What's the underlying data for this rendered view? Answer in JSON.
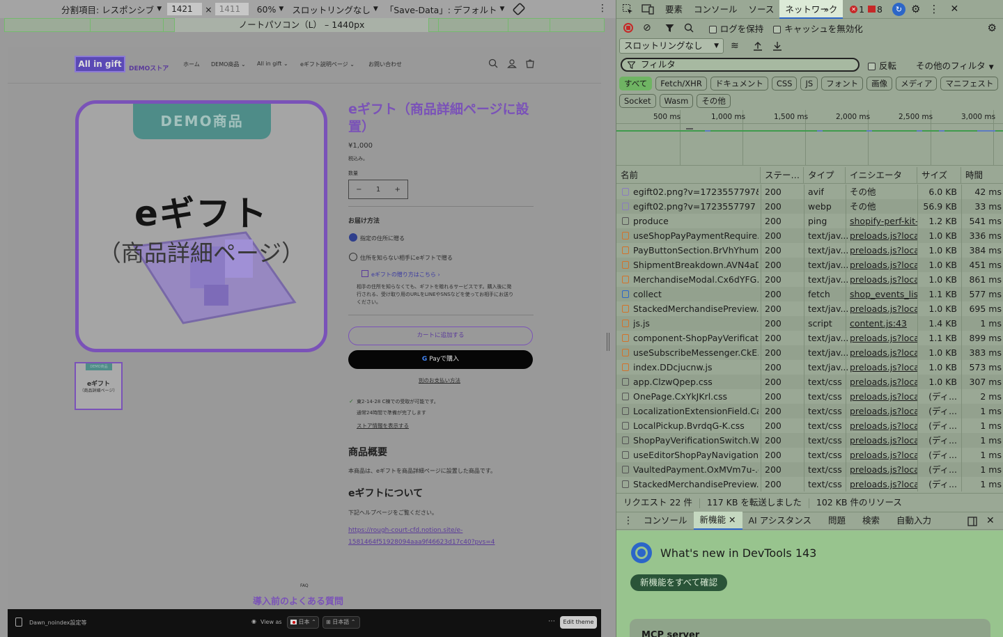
{
  "device_toolbar": {
    "dimension_label": "分割項目: レスポンシブ",
    "width_value": "1421",
    "height_placeholder": "1411",
    "zoom": "60%",
    "throttling": "スロットリングなし",
    "save_data": "「Save-Data」: デフォルト",
    "media_query_label": "ノートパソコン（L） – 1440px"
  },
  "store": {
    "logo_text": "All in gift",
    "store_name": "DEMOストア",
    "nav": [
      {
        "label": "ホーム"
      },
      {
        "label": "DEMO商品"
      },
      {
        "label": "All in gift"
      },
      {
        "label": "eギフト説明ページ"
      },
      {
        "label": "お問い合わせ"
      }
    ],
    "image_badge": "DEMO商品",
    "image_title": "eギフト",
    "image_subtitle": "（商品詳細ページ）",
    "thumb_badge": "DEMO商品",
    "thumb_title": "eギフト",
    "thumb_subtitle": "（商品詳細ページ）",
    "product_title": "eギフト（商品詳細ページに設置）",
    "price": "¥1,000",
    "tax_note": "税込み。",
    "quantity_label": "数量",
    "quantity_value": "1",
    "delivery_heading": "お届け方法",
    "option_address": "指定の住所に贈る",
    "option_egift": "住所を知らない相手にeギフトで贈る",
    "how_to_link": "eギフトの贈り方はこちら ›",
    "egift_desc_1": "相手の住所を知らなくても、ギフトを贈れるサービスです。購入後に発",
    "egift_desc_2": "行される、受け取り用のURLをLINEやSNSなどを使ってお相手にお送り",
    "egift_desc_3": "ください。",
    "add_to_cart": "カートに追加する",
    "gpay_label": "Payで購入",
    "other_payment": "別のお支払い方法",
    "pickup_text": "東2-14-28 C棟での受取が可能です。",
    "pickup_time": "通常24時間で準備が完了します",
    "store_info_link": "ストア情報を表示する",
    "overview_heading": "商品概要",
    "overview_text": "本商品は、eギフトを商品詳細ページに設置した商品です。",
    "about_heading": "eギフトについて",
    "about_text": "下記ヘルプページをご覧ください。",
    "help_link_1": "https://rough-court-cfd.notion.site/e-",
    "help_link_2": "1581464f51928094aaa9f46623d17c40?pvs=4",
    "faq_kicker": "FAQ",
    "faq_heading": "導入前のよくある質問"
  },
  "admin_bar": {
    "theme_name": "Dawn_noindex設定等",
    "view_as": "View as",
    "country": "日本",
    "language": "日本語",
    "edit_theme": "Edit theme"
  },
  "devtools": {
    "tabs": [
      {
        "label": "要素"
      },
      {
        "label": "コンソール"
      },
      {
        "label": "ソース"
      },
      {
        "label": "ネットワーク"
      }
    ],
    "error_count": "1",
    "warning_count": "8",
    "preserve_log": "ログを保持",
    "disable_cache": "キャッシュを無効化",
    "throttling": "スロットリングなし",
    "filter_placeholder": "フィルタ",
    "invert": "反転",
    "more_filters": "その他のフィルタ",
    "type_filters": [
      "すべて",
      "Fetch/XHR",
      "ドキュメント",
      "CSS",
      "JS",
      "フォント",
      "画像",
      "メディア",
      "マニフェスト",
      "Socket",
      "Wasm",
      "その他"
    ],
    "timeline_ticks": [
      "500 ms",
      "1,000 ms",
      "1,500 ms",
      "2,000 ms",
      "2,500 ms",
      "3,000 ms"
    ],
    "columns": [
      "名前",
      "ステー…",
      "タイプ",
      "イニシエータ",
      "サイズ",
      "時間"
    ],
    "rows": [
      {
        "name": "egift02.png?v=1723557797&...",
        "status": "200",
        "type": "avif",
        "initiator": "その他",
        "size": "6.0 KB",
        "time": "42 ms",
        "icon": "image-icon",
        "link": false
      },
      {
        "name": "egift02.png?v=1723557797",
        "status": "200",
        "type": "webp",
        "initiator": "その他",
        "size": "56.9 KB",
        "time": "33 ms",
        "icon": "image-icon",
        "link": false
      },
      {
        "name": "produce",
        "status": "200",
        "type": "ping",
        "initiator": "shopify-perf-kit-2",
        "size": "1.2 KB",
        "time": "541 ms",
        "icon": "document-icon",
        "link": true
      },
      {
        "name": "useShopPayPaymentRequire...",
        "status": "200",
        "type": "text/jav...",
        "initiator": "preloads.js?locale",
        "size": "1.0 KB",
        "time": "336 ms",
        "icon": "script-icon",
        "link": true
      },
      {
        "name": "PayButtonSection.BrVhYhum.js",
        "status": "200",
        "type": "text/jav...",
        "initiator": "preloads.js?locale",
        "size": "1.0 KB",
        "time": "384 ms",
        "icon": "script-icon",
        "link": true
      },
      {
        "name": "ShipmentBreakdown.AVN4aD...",
        "status": "200",
        "type": "text/jav...",
        "initiator": "preloads.js?locale",
        "size": "1.0 KB",
        "time": "451 ms",
        "icon": "script-icon",
        "link": true
      },
      {
        "name": "MerchandiseModal.Cx6dYFG...",
        "status": "200",
        "type": "text/jav...",
        "initiator": "preloads.js?locale",
        "size": "1.0 KB",
        "time": "861 ms",
        "icon": "script-icon",
        "link": true
      },
      {
        "name": "collect",
        "status": "200",
        "type": "fetch",
        "initiator": "shop_events_liste",
        "size": "1.1 KB",
        "time": "577 ms",
        "icon": "fetch-icon",
        "link": true
      },
      {
        "name": "StackedMerchandisePreview....",
        "status": "200",
        "type": "text/jav...",
        "initiator": "preloads.js?locale",
        "size": "1.0 KB",
        "time": "695 ms",
        "icon": "script-icon",
        "link": true
      },
      {
        "name": "js.js",
        "status": "200",
        "type": "script",
        "initiator": "content.js:43",
        "size": "1.4 KB",
        "time": "1 ms",
        "icon": "script-icon",
        "link": true
      },
      {
        "name": "component-ShopPayVerificati...",
        "status": "200",
        "type": "text/jav...",
        "initiator": "preloads.js?locale",
        "size": "1.1 KB",
        "time": "899 ms",
        "icon": "script-icon",
        "link": true
      },
      {
        "name": "useSubscribeMessenger.CkE...",
        "status": "200",
        "type": "text/jav...",
        "initiator": "preloads.js?locale",
        "size": "1.0 KB",
        "time": "383 ms",
        "icon": "script-icon",
        "link": true
      },
      {
        "name": "index.DDcjucnw.js",
        "status": "200",
        "type": "text/jav...",
        "initiator": "preloads.js?locale",
        "size": "1.0 KB",
        "time": "573 ms",
        "icon": "script-icon",
        "link": true
      },
      {
        "name": "app.ClzwQpep.css",
        "status": "200",
        "type": "text/css",
        "initiator": "preloads.js?locale",
        "size": "1.0 KB",
        "time": "307 ms",
        "icon": "css-icon",
        "link": true
      },
      {
        "name": "OnePage.CxYkJKrl.css",
        "status": "200",
        "type": "text/css",
        "initiator": "preloads.js?locale",
        "size": "(ディ...",
        "time": "2 ms",
        "icon": "css-icon",
        "link": true
      },
      {
        "name": "LocalizationExtensionField.Ca...",
        "status": "200",
        "type": "text/css",
        "initiator": "preloads.js?locale",
        "size": "(ディ...",
        "time": "1 ms",
        "icon": "css-icon",
        "link": true
      },
      {
        "name": "LocalPickup.BvrdqG-K.css",
        "status": "200",
        "type": "text/css",
        "initiator": "preloads.js?locale",
        "size": "(ディ...",
        "time": "1 ms",
        "icon": "css-icon",
        "link": true
      },
      {
        "name": "ShopPayVerificationSwitch.W...",
        "status": "200",
        "type": "text/css",
        "initiator": "preloads.js?locale",
        "size": "(ディ...",
        "time": "1 ms",
        "icon": "css-icon",
        "link": true
      },
      {
        "name": "useEditorShopPayNavigation....",
        "status": "200",
        "type": "text/css",
        "initiator": "preloads.js?locale",
        "size": "(ディ...",
        "time": "1 ms",
        "icon": "css-icon",
        "link": true
      },
      {
        "name": "VaultedPayment.OxMVm7u-.c...",
        "status": "200",
        "type": "text/css",
        "initiator": "preloads.js?locale",
        "size": "(ディ...",
        "time": "1 ms",
        "icon": "css-icon",
        "link": true
      },
      {
        "name": "StackedMerchandisePreview....",
        "status": "200",
        "type": "text/css",
        "initiator": "preloads.js?locale",
        "size": "(ディ...",
        "time": "1 ms",
        "icon": "css-icon",
        "link": true
      }
    ],
    "summary": [
      "リクエスト 22 件",
      "117 KB を転送しました",
      "102 KB 件のリソース"
    ],
    "drawer_tabs": [
      {
        "label": "コンソール"
      },
      {
        "label": "新機能"
      },
      {
        "label": "AI アシスタンス"
      },
      {
        "label": "問題"
      },
      {
        "label": "検索"
      },
      {
        "label": "自動入力"
      }
    ],
    "whatsnew_title": "What's new in DevTools 143",
    "whatsnew_button": "新機能をすべて確認",
    "card_title": "MCP server"
  },
  "colors": {
    "brand_purple": "#7a52b8",
    "devtools_selected_chip": "#6fb463",
    "link_blue": "#2c66c8"
  }
}
